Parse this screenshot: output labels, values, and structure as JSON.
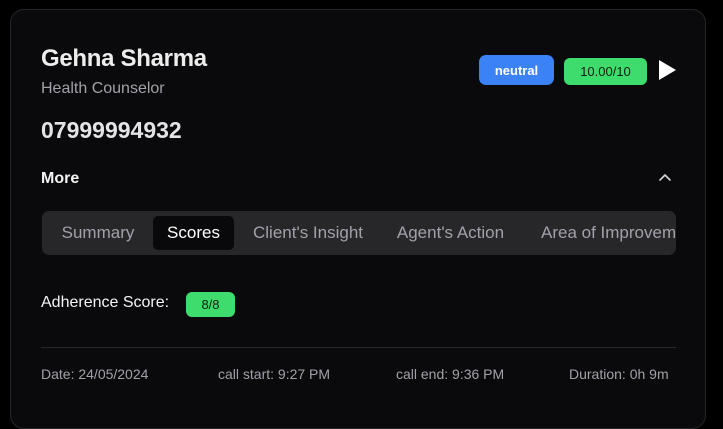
{
  "agent": {
    "name": "Gehna Sharma",
    "role": "Health Counselor",
    "phone": "07999994932"
  },
  "badges": {
    "sentiment": "neutral",
    "score": "10.00/10",
    "sentiment_color": "#3b82f6",
    "score_color": "#3ddc6c"
  },
  "icons": {
    "play": "play-icon",
    "collapse": "chevron-up-icon"
  },
  "more": {
    "label": "More"
  },
  "tabs": [
    {
      "label": "Summary",
      "active": false
    },
    {
      "label": "Scores",
      "active": true
    },
    {
      "label": "Client's Insight",
      "active": false
    },
    {
      "label": "Agent's Action",
      "active": false
    },
    {
      "label": "Area of Improvement",
      "active": false
    }
  ],
  "scores": {
    "adherence_label": "Adherence Score:",
    "adherence_value": "8/8"
  },
  "footer": {
    "date": "Date: 24/05/2024",
    "call_start": "call start: 9:27 PM",
    "call_end": "call end: 9:36 PM",
    "duration": "Duration: 0h 9m"
  }
}
